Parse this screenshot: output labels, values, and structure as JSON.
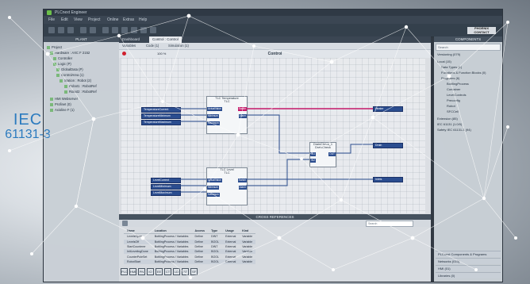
{
  "overlay_text": {
    "line1": "IEC",
    "line2": "61131-3"
  },
  "window": {
    "title": "PLCnext Engineer"
  },
  "menu": [
    "File",
    "Edit",
    "View",
    "Project",
    "Online",
    "Extras",
    "Help"
  ],
  "brand": {
    "line1": "PHOENIX",
    "line2": "CONTACT"
  },
  "left_panel": {
    "header": "PLANT",
    "tree": [
      "Project",
      "Hardware : AXC F 2152",
      "Controller",
      "Logic (P)",
      "GlobalData (P)",
      "ControlArea (1)",
      "Station : Robot (2)",
      "Robot1 : RobotRef",
      "Robot2 : RobotRef",
      "HMI Webserver",
      "Profinet (0)",
      "Axioline F (1)"
    ]
  },
  "editor": {
    "tabs": [
      {
        "label": "Dashboard",
        "active": false
      },
      {
        "label": "Control : Control",
        "active": true
      }
    ],
    "subtabs": [
      "Variables",
      "Code (1)",
      "Simulation (1)"
    ],
    "title": "Control",
    "toolbar_text": "100 %",
    "blocks": {
      "temp": {
        "name": "TLC Temperature",
        "type": "TLC",
        "pins_in": [
          "ActualValue",
          "Minimum",
          "Maximum"
        ],
        "pins_out": [
          "Switch",
          "Alarm"
        ]
      },
      "level": {
        "name": "TLC Level",
        "type": "TLC",
        "pins_in": [
          "ActualValue",
          "Minimum",
          "Maximum"
        ],
        "pins_out": [
          "Switch",
          "Alarm"
        ]
      },
      "or": {
        "name": "DrainCheck_1",
        "type": "DrainCheck",
        "pins_in": [
          "IN1",
          "IN2"
        ],
        "pins_out": [
          "OUT"
        ]
      }
    },
    "inputs": [
      "TemperatureCurrent",
      "TemperatureMinimum",
      "TemperatureMaximum",
      "LevelCurrent",
      "LevelMinimum",
      "LevelMaximum"
    ],
    "outputs": [
      "Heater",
      "Drain",
      "Inlets"
    ]
  },
  "xref": {
    "title": "CROSS REFERENCES",
    "search_placeholder": "Search",
    "columns": [
      "Name",
      "Location",
      "Access",
      "Type",
      "Usage",
      "Kind"
    ],
    "rows": [
      [
        "LevelsOpen",
        "BottlingProcess / Variables",
        "Define",
        "DINT",
        "External",
        "Variable"
      ],
      [
        "LevelsOff",
        "BottlingProcess / Variables",
        "Define",
        "BOOL",
        "External",
        "Variable"
      ],
      [
        "StartCounterer",
        "BottlingProcess / Variables",
        "Define",
        "DINT",
        "External",
        "Variable"
      ],
      [
        "InitLevelingDone",
        "BottlingProcess / Variables",
        "Define",
        "BOOL",
        "External",
        "Variable"
      ],
      [
        "CounterPoleSet",
        "BottlingProcess / Variables",
        "Define",
        "BOOL",
        "External",
        "Variable"
      ],
      [
        "RobotStart",
        "BottlingProcess / Variables",
        "Define",
        "BOOL",
        "External",
        "Variable"
      ]
    ]
  },
  "right_panel": {
    "header": "COMPONENTS",
    "search_placeholder": "Search",
    "tree": [
      "Versioning (079)",
      "Local (15)",
      "Data Types (1)",
      "Functions & Function Blocks (0)",
      "Programs (6)",
      "BottlingProcess",
      "Container",
      "LevelControls",
      "Preconfig",
      "Robot",
      "SFCCell",
      "Extension (85)",
      "IEC 61131 (1.0/0)",
      "Safety IEC 61131-3 (94)"
    ],
    "bottom_sections": [
      "PLCnext Components & Programs",
      "Networks (010)",
      "HMI (01)",
      "Libraries (0)"
    ]
  },
  "bottom_toolbar": [
    "PLC",
    "HMI",
    "PN",
    "IO",
    "EE",
    "CT",
    "LD",
    "ST",
    "SF"
  ],
  "colors": {
    "accent_pink": "#c51b6b",
    "var_blue": "#2b4d8f",
    "record_red": "#d0202e",
    "iec_blue": "#2c7bbf"
  }
}
